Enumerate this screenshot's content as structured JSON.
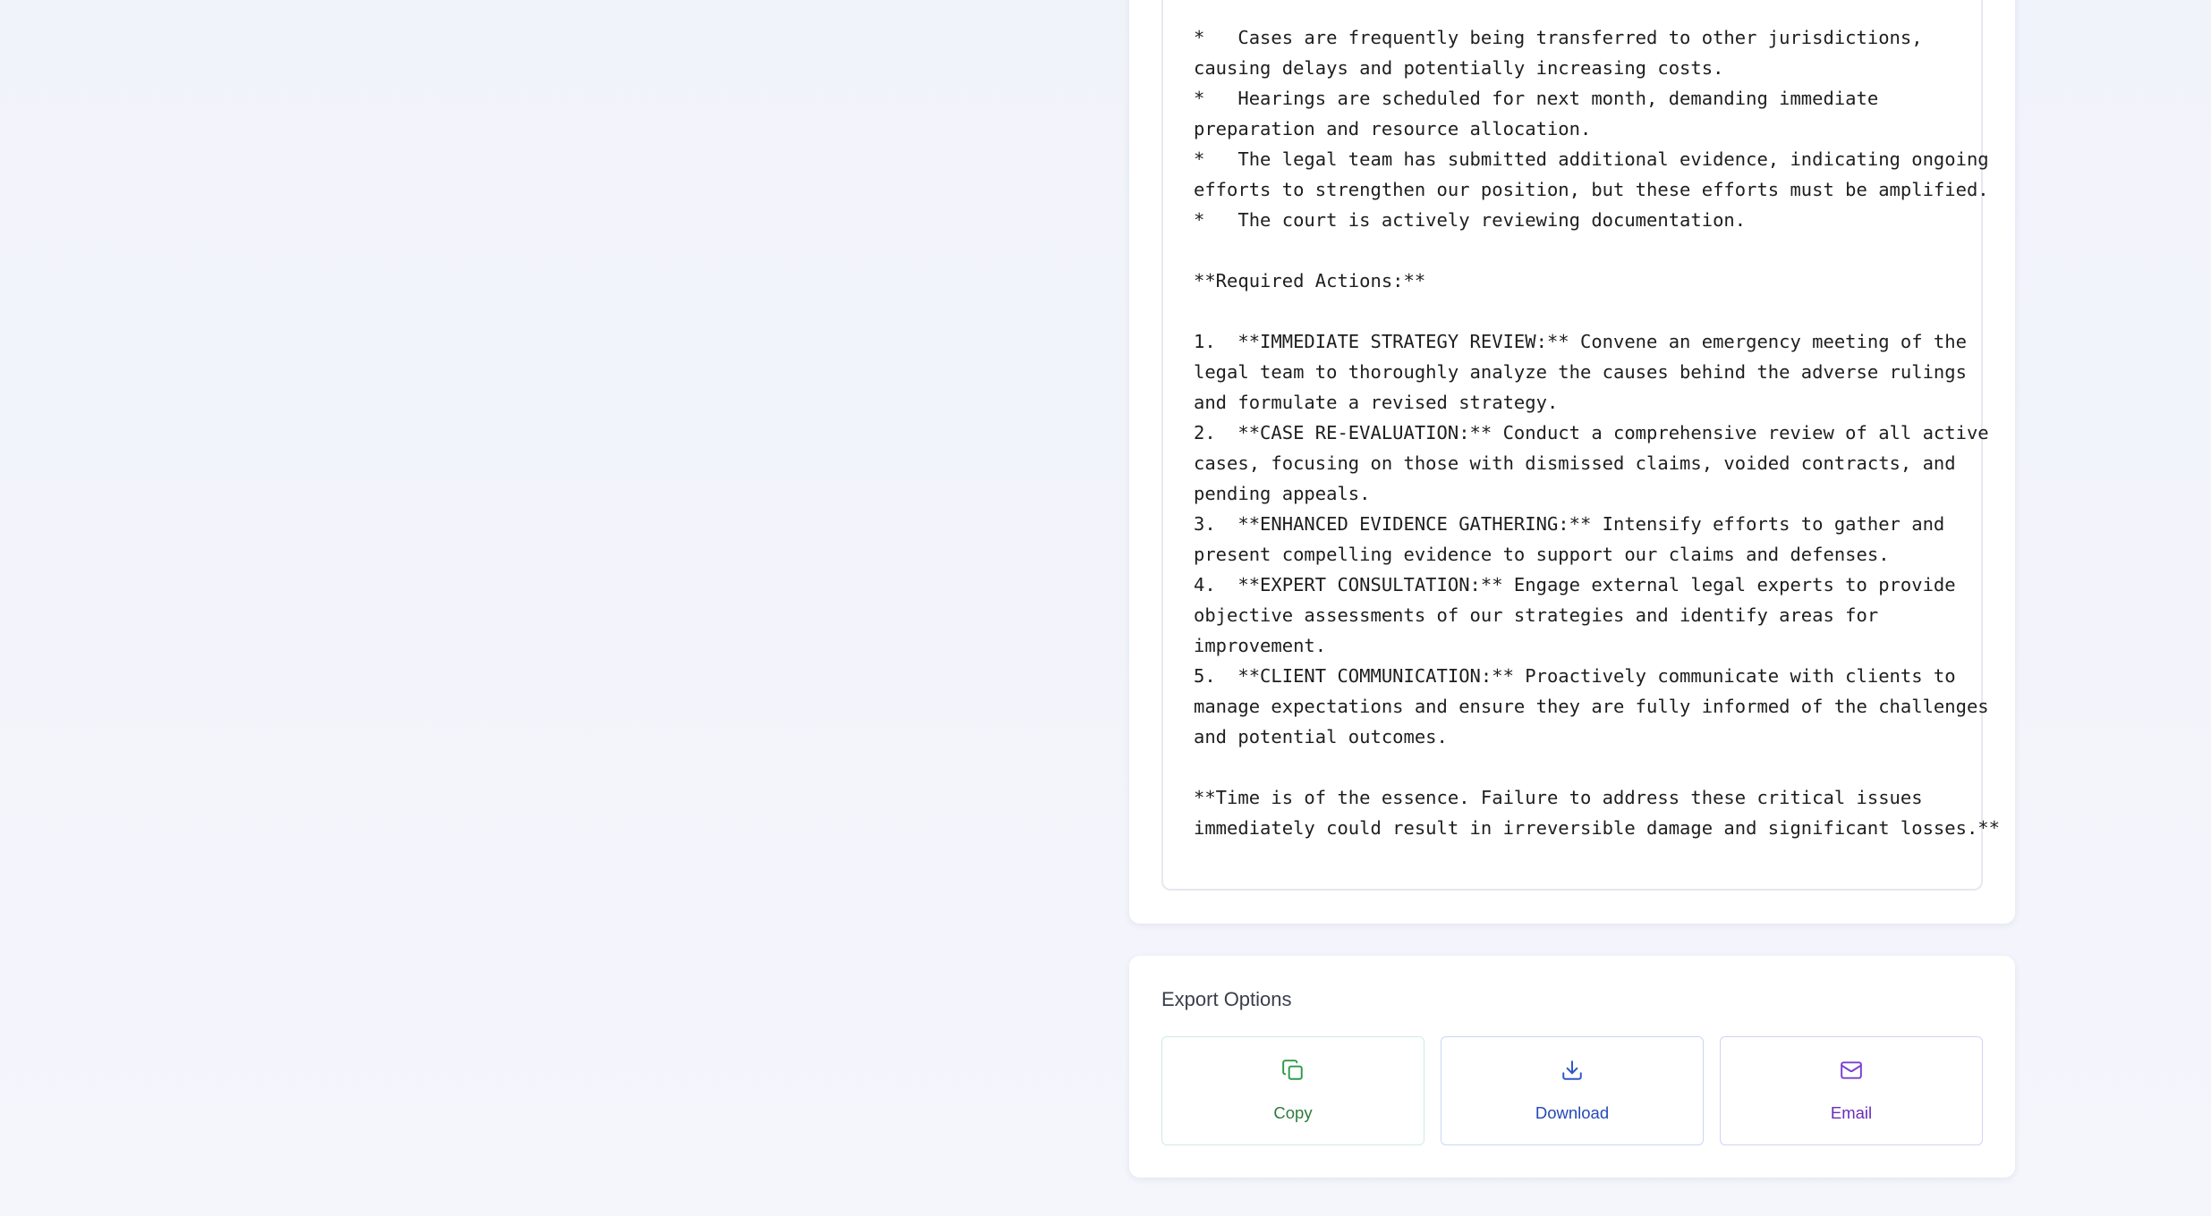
{
  "report": {
    "lines": [
      "*   Cases are frequently being transferred to other jurisdictions,",
      "causing delays and potentially increasing costs.",
      "*   Hearings are scheduled for next month, demanding immediate",
      "preparation and resource allocation.",
      "*   The legal team has submitted additional evidence, indicating ongoing",
      "efforts to strengthen our position, but these efforts must be amplified.",
      "*   The court is actively reviewing documentation.",
      "",
      "**Required Actions:**",
      "",
      "1.  **IMMEDIATE STRATEGY REVIEW:** Convene an emergency meeting of the",
      "legal team to thoroughly analyze the causes behind the adverse rulings",
      "and formulate a revised strategy.",
      "2.  **CASE RE-EVALUATION:** Conduct a comprehensive review of all active",
      "cases, focusing on those with dismissed claims, voided contracts, and",
      "pending appeals.",
      "3.  **ENHANCED EVIDENCE GATHERING:** Intensify efforts to gather and",
      "present compelling evidence to support our claims and defenses.",
      "4.  **EXPERT CONSULTATION:** Engage external legal experts to provide",
      "objective assessments of our strategies and identify areas for",
      "improvement.",
      "5.  **CLIENT COMMUNICATION:** Proactively communicate with clients to",
      "manage expectations and ensure they are fully informed of the challenges",
      "and potential outcomes.",
      "",
      "**Time is of the essence. Failure to address these critical issues",
      "immediately could result in irreversible damage and significant losses.**"
    ]
  },
  "export": {
    "title": "Export Options",
    "buttons": [
      {
        "label": "Copy",
        "icon": "copy-icon",
        "color": "#2f7a3d"
      },
      {
        "label": "Download",
        "icon": "download-icon",
        "color": "#2449b8"
      },
      {
        "label": "Email",
        "icon": "mail-icon",
        "color": "#6a2bbd"
      }
    ]
  }
}
